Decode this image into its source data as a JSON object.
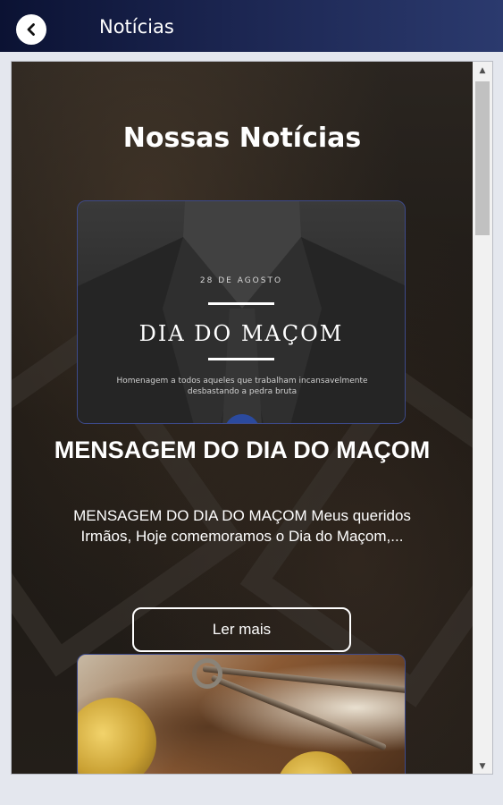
{
  "appbar": {
    "title": "Notícias"
  },
  "page": {
    "section_title": "Nossas Notícias"
  },
  "articles": [
    {
      "image": {
        "date": "28 DE AGOSTO",
        "heading": "DIA DO MAÇOM",
        "caption": "Homenagem a todos aqueles que trabalham incansavelmente desbastando a pedra bruta"
      },
      "title": "MENSAGEM DO DIA DO MAÇOM",
      "excerpt": "MENSAGEM DO DIA DO MAÇOM Meus queridos Irmãos,  Hoje comemoramos o Dia do Maçom,...",
      "button_label": "Ler mais"
    }
  ],
  "icons": {
    "back": "chevron-left-icon",
    "scroll_up": "triangle-up-icon",
    "scroll_down": "triangle-down-icon"
  },
  "colors": {
    "appbar_gradient_start": "#0b1233",
    "appbar_gradient_end": "#2b3a6e",
    "card_border": "#3d4a8a",
    "text": "#ffffff"
  }
}
